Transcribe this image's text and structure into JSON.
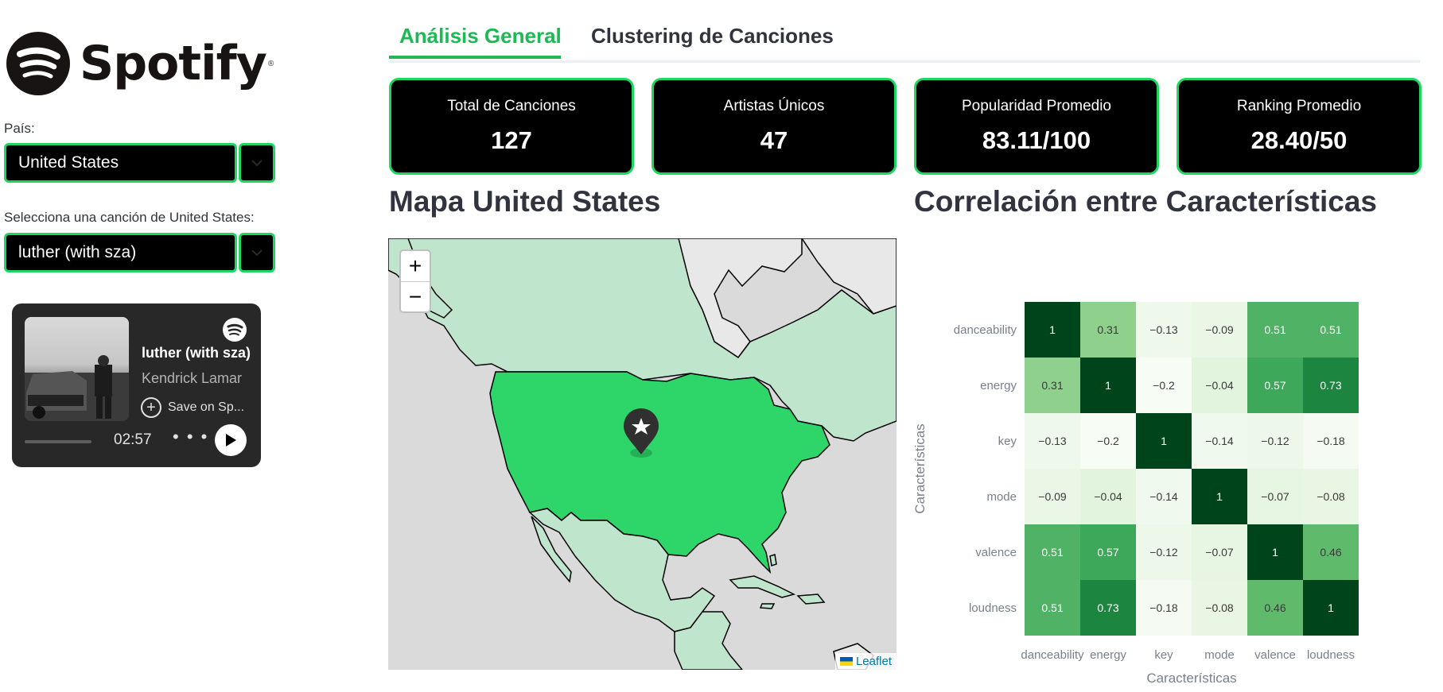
{
  "sidebar": {
    "logo_text": "Spotify",
    "country_label": "País:",
    "country_value": "United States",
    "song_label": "Selecciona una canción de United States:",
    "song_value": "luther (with sza)",
    "player": {
      "title": "luther (with sza)",
      "artist": "Kendrick Lamar",
      "save_label": "Save on Sp...",
      "time": "02:57",
      "more": "• • •",
      "progress": 0.3
    }
  },
  "tabs": [
    {
      "label": "Análisis General",
      "active": true
    },
    {
      "label": "Clustering de Canciones",
      "active": false
    }
  ],
  "metrics": [
    {
      "label": "Total de Canciones",
      "value": "127"
    },
    {
      "label": "Artistas Únicos",
      "value": "47"
    },
    {
      "label": "Popularidad Promedio",
      "value": "83.11/100"
    },
    {
      "label": "Ranking Promedio",
      "value": "28.40/50"
    }
  ],
  "map": {
    "title": "Mapa United States",
    "zoom_in": "+",
    "zoom_out": "−",
    "attribution": "Leaflet",
    "highlight_color": "#2ed66a",
    "other_land_color": "#bfe6cc",
    "outside_color": "#e8e8e8",
    "water_color": "#dadada"
  },
  "heatmap_title": "Correlación entre Características",
  "chart_data": {
    "type": "heatmap",
    "title": "",
    "xlabel": "Características",
    "ylabel": "Características",
    "x": [
      "danceability",
      "energy",
      "key",
      "mode",
      "valence",
      "loudness"
    ],
    "y": [
      "danceability",
      "energy",
      "key",
      "mode",
      "valence",
      "loudness"
    ],
    "values": [
      [
        1,
        0.31,
        -0.13,
        -0.09,
        0.51,
        0.51
      ],
      [
        0.31,
        1,
        -0.2,
        -0.04,
        0.57,
        0.73
      ],
      [
        -0.13,
        -0.2,
        1,
        -0.14,
        -0.12,
        -0.18
      ],
      [
        -0.09,
        -0.04,
        -0.14,
        1,
        -0.07,
        -0.08
      ],
      [
        0.51,
        0.57,
        -0.12,
        -0.07,
        1,
        0.46
      ],
      [
        0.51,
        0.73,
        -0.18,
        -0.08,
        0.46,
        1
      ]
    ],
    "labels": [
      [
        "1",
        "0.31",
        "−0.13",
        "−0.09",
        "0.51",
        "0.51"
      ],
      [
        "0.31",
        "1",
        "−0.2",
        "−0.04",
        "0.57",
        "0.73"
      ],
      [
        "−0.13",
        "−0.2",
        "1",
        "−0.14",
        "−0.12",
        "−0.18"
      ],
      [
        "−0.09",
        "−0.04",
        "−0.14",
        "1",
        "−0.07",
        "−0.08"
      ],
      [
        "0.51",
        "0.57",
        "−0.12",
        "−0.07",
        "1",
        "0.46"
      ],
      [
        "0.51",
        "0.73",
        "−0.18",
        "−0.08",
        "0.46",
        "1"
      ]
    ],
    "colorscale": "Greens",
    "range": [
      -0.2,
      1
    ]
  }
}
